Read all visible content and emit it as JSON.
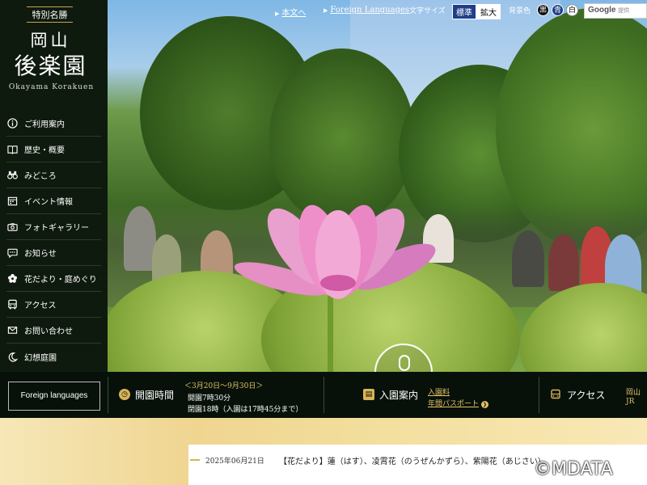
{
  "header": {
    "link_home": "本文へ",
    "link_foreign": "Foreign Languages",
    "font_size_label": "文字サイズ",
    "font_size_standard": "標準",
    "font_size_large": "拡大",
    "bg_color_label": "背景色",
    "bg_black": "黒",
    "bg_blue": "青",
    "bg_white": "白",
    "search_brand": "Google",
    "search_suffix": "提供"
  },
  "logo": {
    "badge": "特別名勝",
    "name_line1": "岡山",
    "name_line2": "後楽園",
    "roman": "Okayama Korakuen"
  },
  "sidebar": {
    "items": [
      {
        "label": "ご利用案内",
        "icon": "info-icon"
      },
      {
        "label": "歴史・概要",
        "icon": "book-icon"
      },
      {
        "label": "みどころ",
        "icon": "binoculars-icon"
      },
      {
        "label": "イベント情報",
        "icon": "calendar-icon"
      },
      {
        "label": "フォトギャラリー",
        "icon": "camera-icon"
      },
      {
        "label": "お知らせ",
        "icon": "speech-bubble-icon"
      },
      {
        "label": "花だより・庭めぐり",
        "icon": "flower-icon"
      },
      {
        "label": "アクセス",
        "icon": "bus-icon"
      },
      {
        "label": "お問い合わせ",
        "icon": "mail-icon"
      },
      {
        "label": "幻想庭園",
        "icon": "moon-icon"
      }
    ]
  },
  "infobar": {
    "foreign_button": "Foreign languages",
    "hours_title": "開園時間",
    "hours_period": "＜3月20日～9月30日＞",
    "hours_open": "開園7時30分",
    "hours_close": "閉園18時（入園は17時45分まで）",
    "admission_title": "入園案内",
    "admission_fee": "入園料",
    "admission_pass": "年間パスポート",
    "access_title": "アクセス",
    "access_line1": "岡山",
    "access_line2": "JR"
  },
  "news": {
    "date": "2025年06月21日",
    "text": "【花だより】蓮（はす）、凌霄花（のうぜんかずら）、紫陽花（あじさい）"
  },
  "watermark": "©MDATA"
}
